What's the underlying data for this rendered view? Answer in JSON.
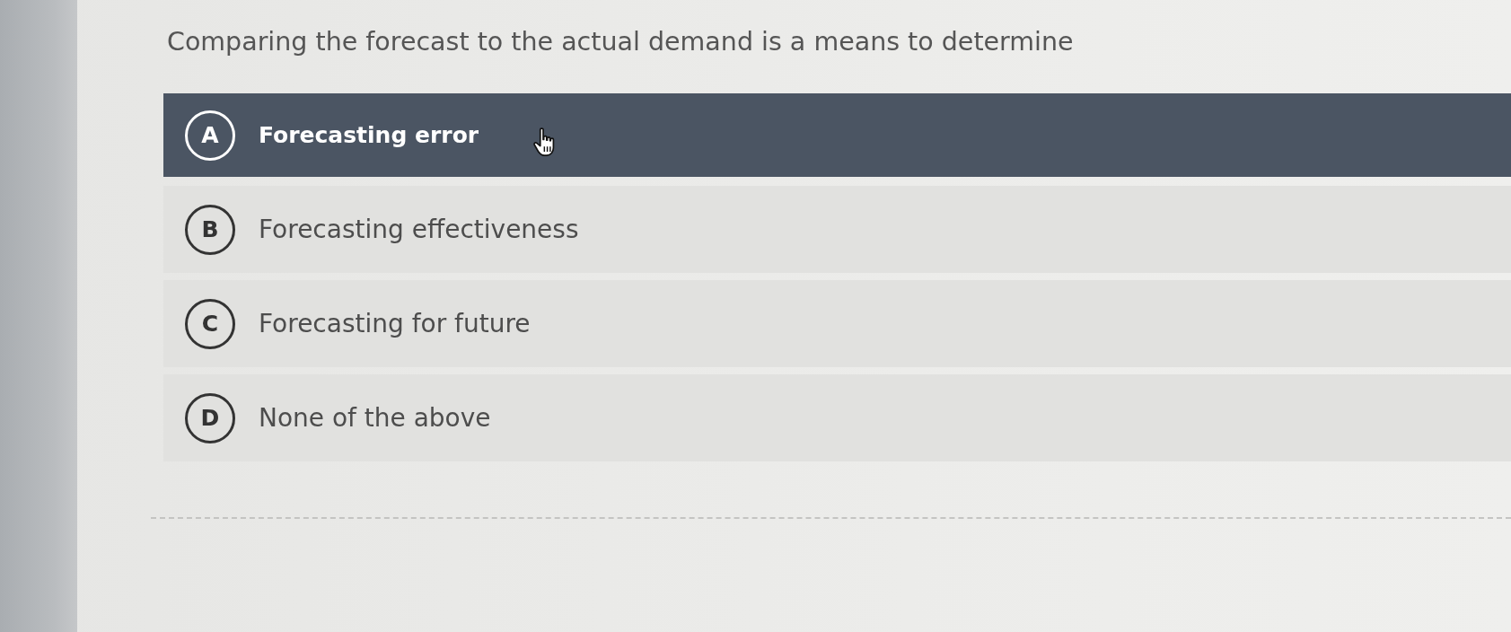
{
  "question": "Comparing the forecast to the actual demand is a means to determine",
  "options": [
    {
      "letter": "A",
      "text": "Forecasting error",
      "selected": true
    },
    {
      "letter": "B",
      "text": "Forecasting effectiveness",
      "selected": false
    },
    {
      "letter": "C",
      "text": "Forecasting for future",
      "selected": false
    },
    {
      "letter": "D",
      "text": "None of the above",
      "selected": false
    }
  ]
}
